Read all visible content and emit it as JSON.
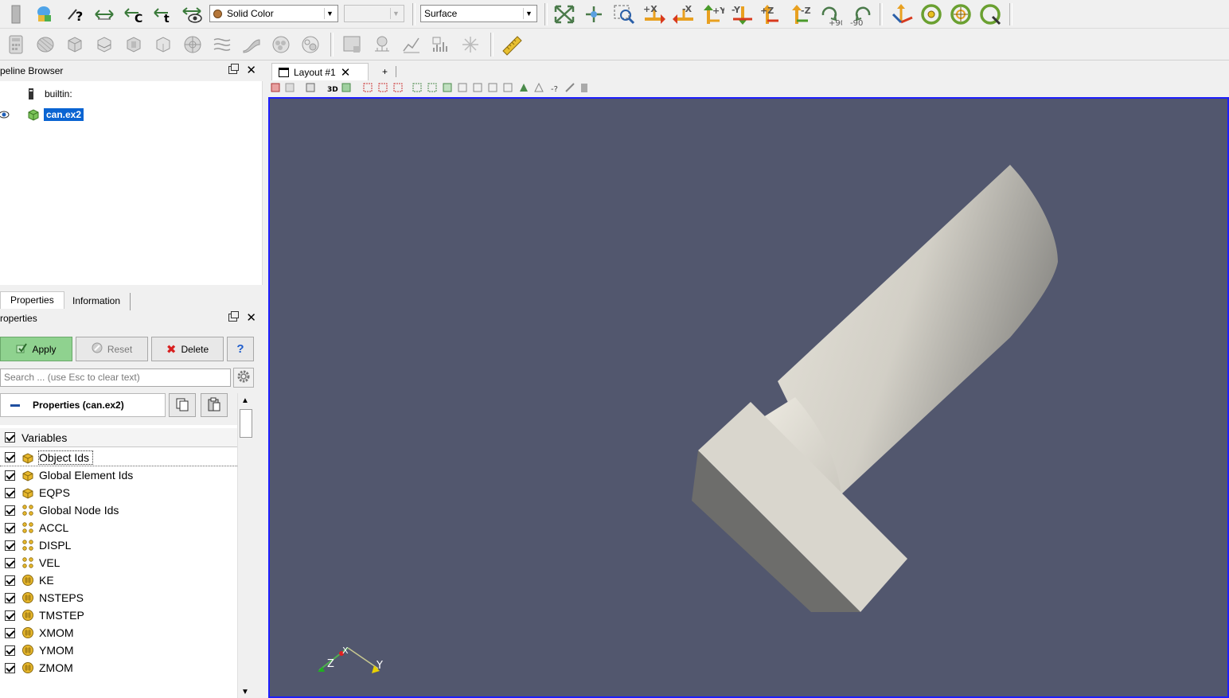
{
  "toolbar": {
    "color_by": "Solid Color",
    "color_component": "",
    "representation": "Surface",
    "rotate_pos_label": "+90",
    "rotate_neg_label": "-90",
    "axis_labels": [
      "+X",
      "-X",
      "+Y",
      "-Y",
      "+Z",
      "-Z"
    ]
  },
  "pipeline": {
    "title": "peline Browser",
    "items": [
      {
        "label": "builtin:"
      },
      {
        "label": "can.ex2"
      }
    ]
  },
  "tabs": {
    "properties": "Properties",
    "information": "Information"
  },
  "properties_panel": {
    "title": "roperties",
    "apply": "Apply",
    "reset": "Reset",
    "delete": "Delete",
    "help": "?",
    "search_placeholder": "Search ... (use Esc to clear text)",
    "section_title": "Properties (can.ex2)",
    "variables_header": "Variables",
    "variables": [
      {
        "name": "Object Ids",
        "icon": "cell-data-icon"
      },
      {
        "name": "Global Element Ids",
        "icon": "cell-data-icon"
      },
      {
        "name": "EQPS",
        "icon": "cell-data-icon"
      },
      {
        "name": "Global Node Ids",
        "icon": "point-data-icon"
      },
      {
        "name": "ACCL",
        "icon": "point-data-icon"
      },
      {
        "name": "DISPL",
        "icon": "point-data-icon"
      },
      {
        "name": "VEL",
        "icon": "point-data-icon"
      },
      {
        "name": "KE",
        "icon": "field-data-icon"
      },
      {
        "name": "NSTEPS",
        "icon": "field-data-icon"
      },
      {
        "name": "TMSTEP",
        "icon": "field-data-icon"
      },
      {
        "name": "XMOM",
        "icon": "field-data-icon"
      },
      {
        "name": "YMOM",
        "icon": "field-data-icon"
      },
      {
        "name": "ZMOM",
        "icon": "field-data-icon"
      }
    ]
  },
  "layout": {
    "tab_label": "Layout #1",
    "add_tab": "+",
    "view_3d_label": "3D",
    "viewport_bg": "#52576e",
    "axes": {
      "x": "X",
      "y": "Y",
      "z": "Z"
    }
  }
}
